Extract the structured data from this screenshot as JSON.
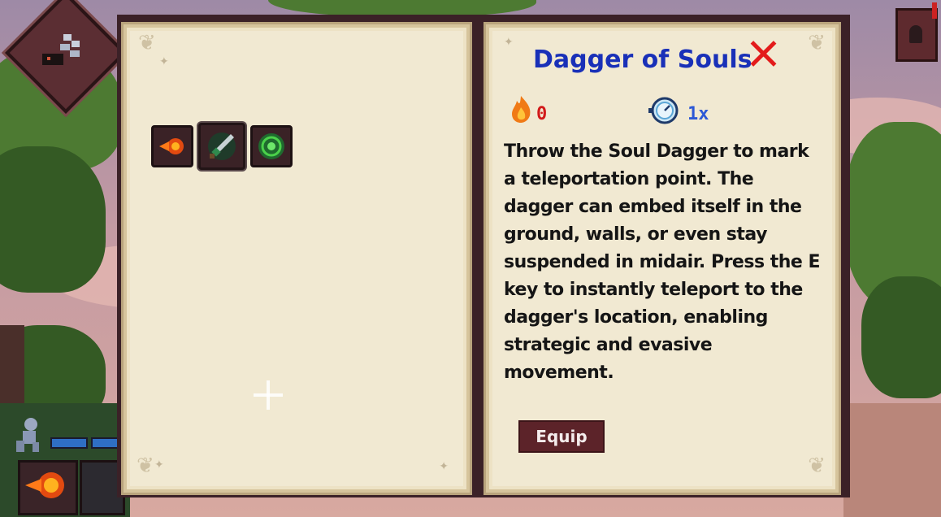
{
  "item": {
    "title": "Dagger of Souls",
    "cost_value": "0",
    "cooldown_value": "1x",
    "description": "Throw the Soul Dagger to mark a teleportation point. The dagger can embed itself in the ground, walls, or even stay suspended in midair. Press the E key to instantly teleport to the dagger's location, enabling strategic and evasive movement.",
    "equip_label": "Equip"
  },
  "inventory": {
    "slots": [
      {
        "icon": "fireball-icon"
      },
      {
        "icon": "soul-dagger-icon"
      },
      {
        "icon": "green-rune-icon"
      }
    ]
  },
  "colors": {
    "title": "#1930b8",
    "cost": "#d21a1a",
    "cooldown": "#2c58d6",
    "close": "#e31b1b",
    "equip_bg": "#5c2329"
  }
}
